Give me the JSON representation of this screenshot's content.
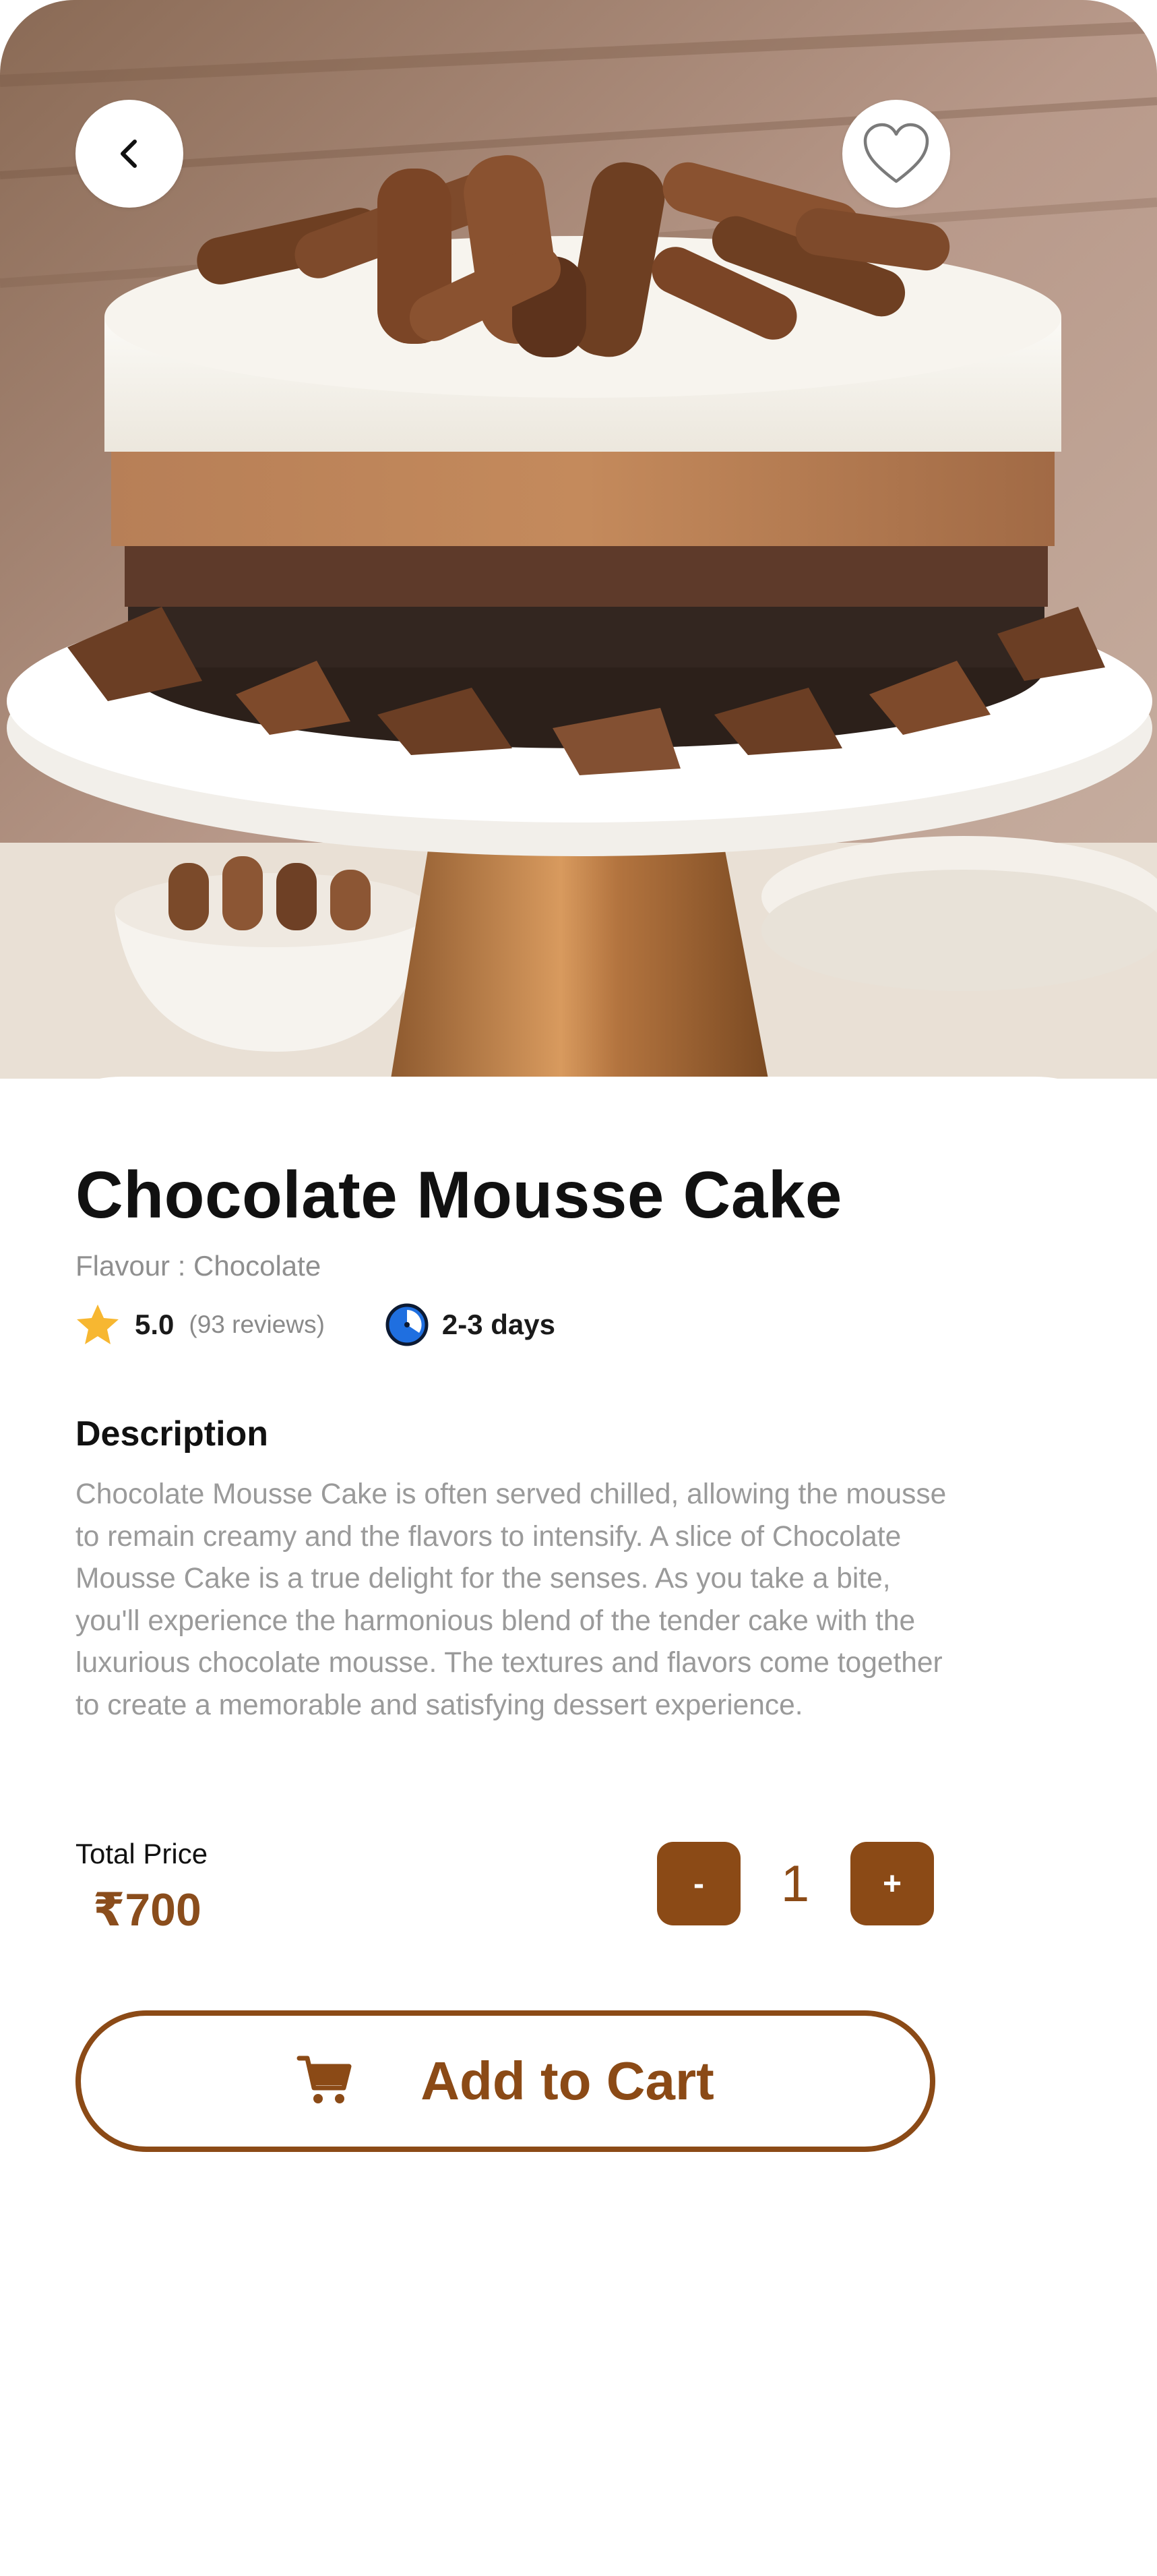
{
  "product": {
    "name": "Chocolate Mousse Cake",
    "flavour": "Flavour : Chocolate",
    "rating": "5.0",
    "reviews": "(93 reviews)",
    "delivery_time": "2-3 days",
    "image_icon": "cake-photo"
  },
  "description": {
    "heading": "Description",
    "body": "Chocolate Mousse Cake is often served chilled, allowing the mousse to remain creamy and the flavors to intensify. A slice of Chocolate Mousse Cake is a true delight for the senses. As you take a bite, you'll experience the harmonious blend of the tender cake with the luxurious chocolate mousse. The textures and flavors come together to create a memorable and satisfying dessert experience."
  },
  "pricing": {
    "total_label": "Total Price",
    "price": "₹700",
    "quantity": "1",
    "decrement_label": "-",
    "increment_label": "+"
  },
  "actions": {
    "add_to_cart_label": "Add to Cart"
  },
  "icons": {
    "back": "chevron-left-icon",
    "favorite": "heart-icon",
    "rating": "star-icon",
    "delivery": "clock-icon",
    "cart": "cart-icon"
  },
  "colors": {
    "accent": "#8b4a16",
    "price": "#8a4d1c",
    "star": "#f7b731",
    "clock": "#1f6fe0",
    "muted_text": "#9a9a9a"
  }
}
